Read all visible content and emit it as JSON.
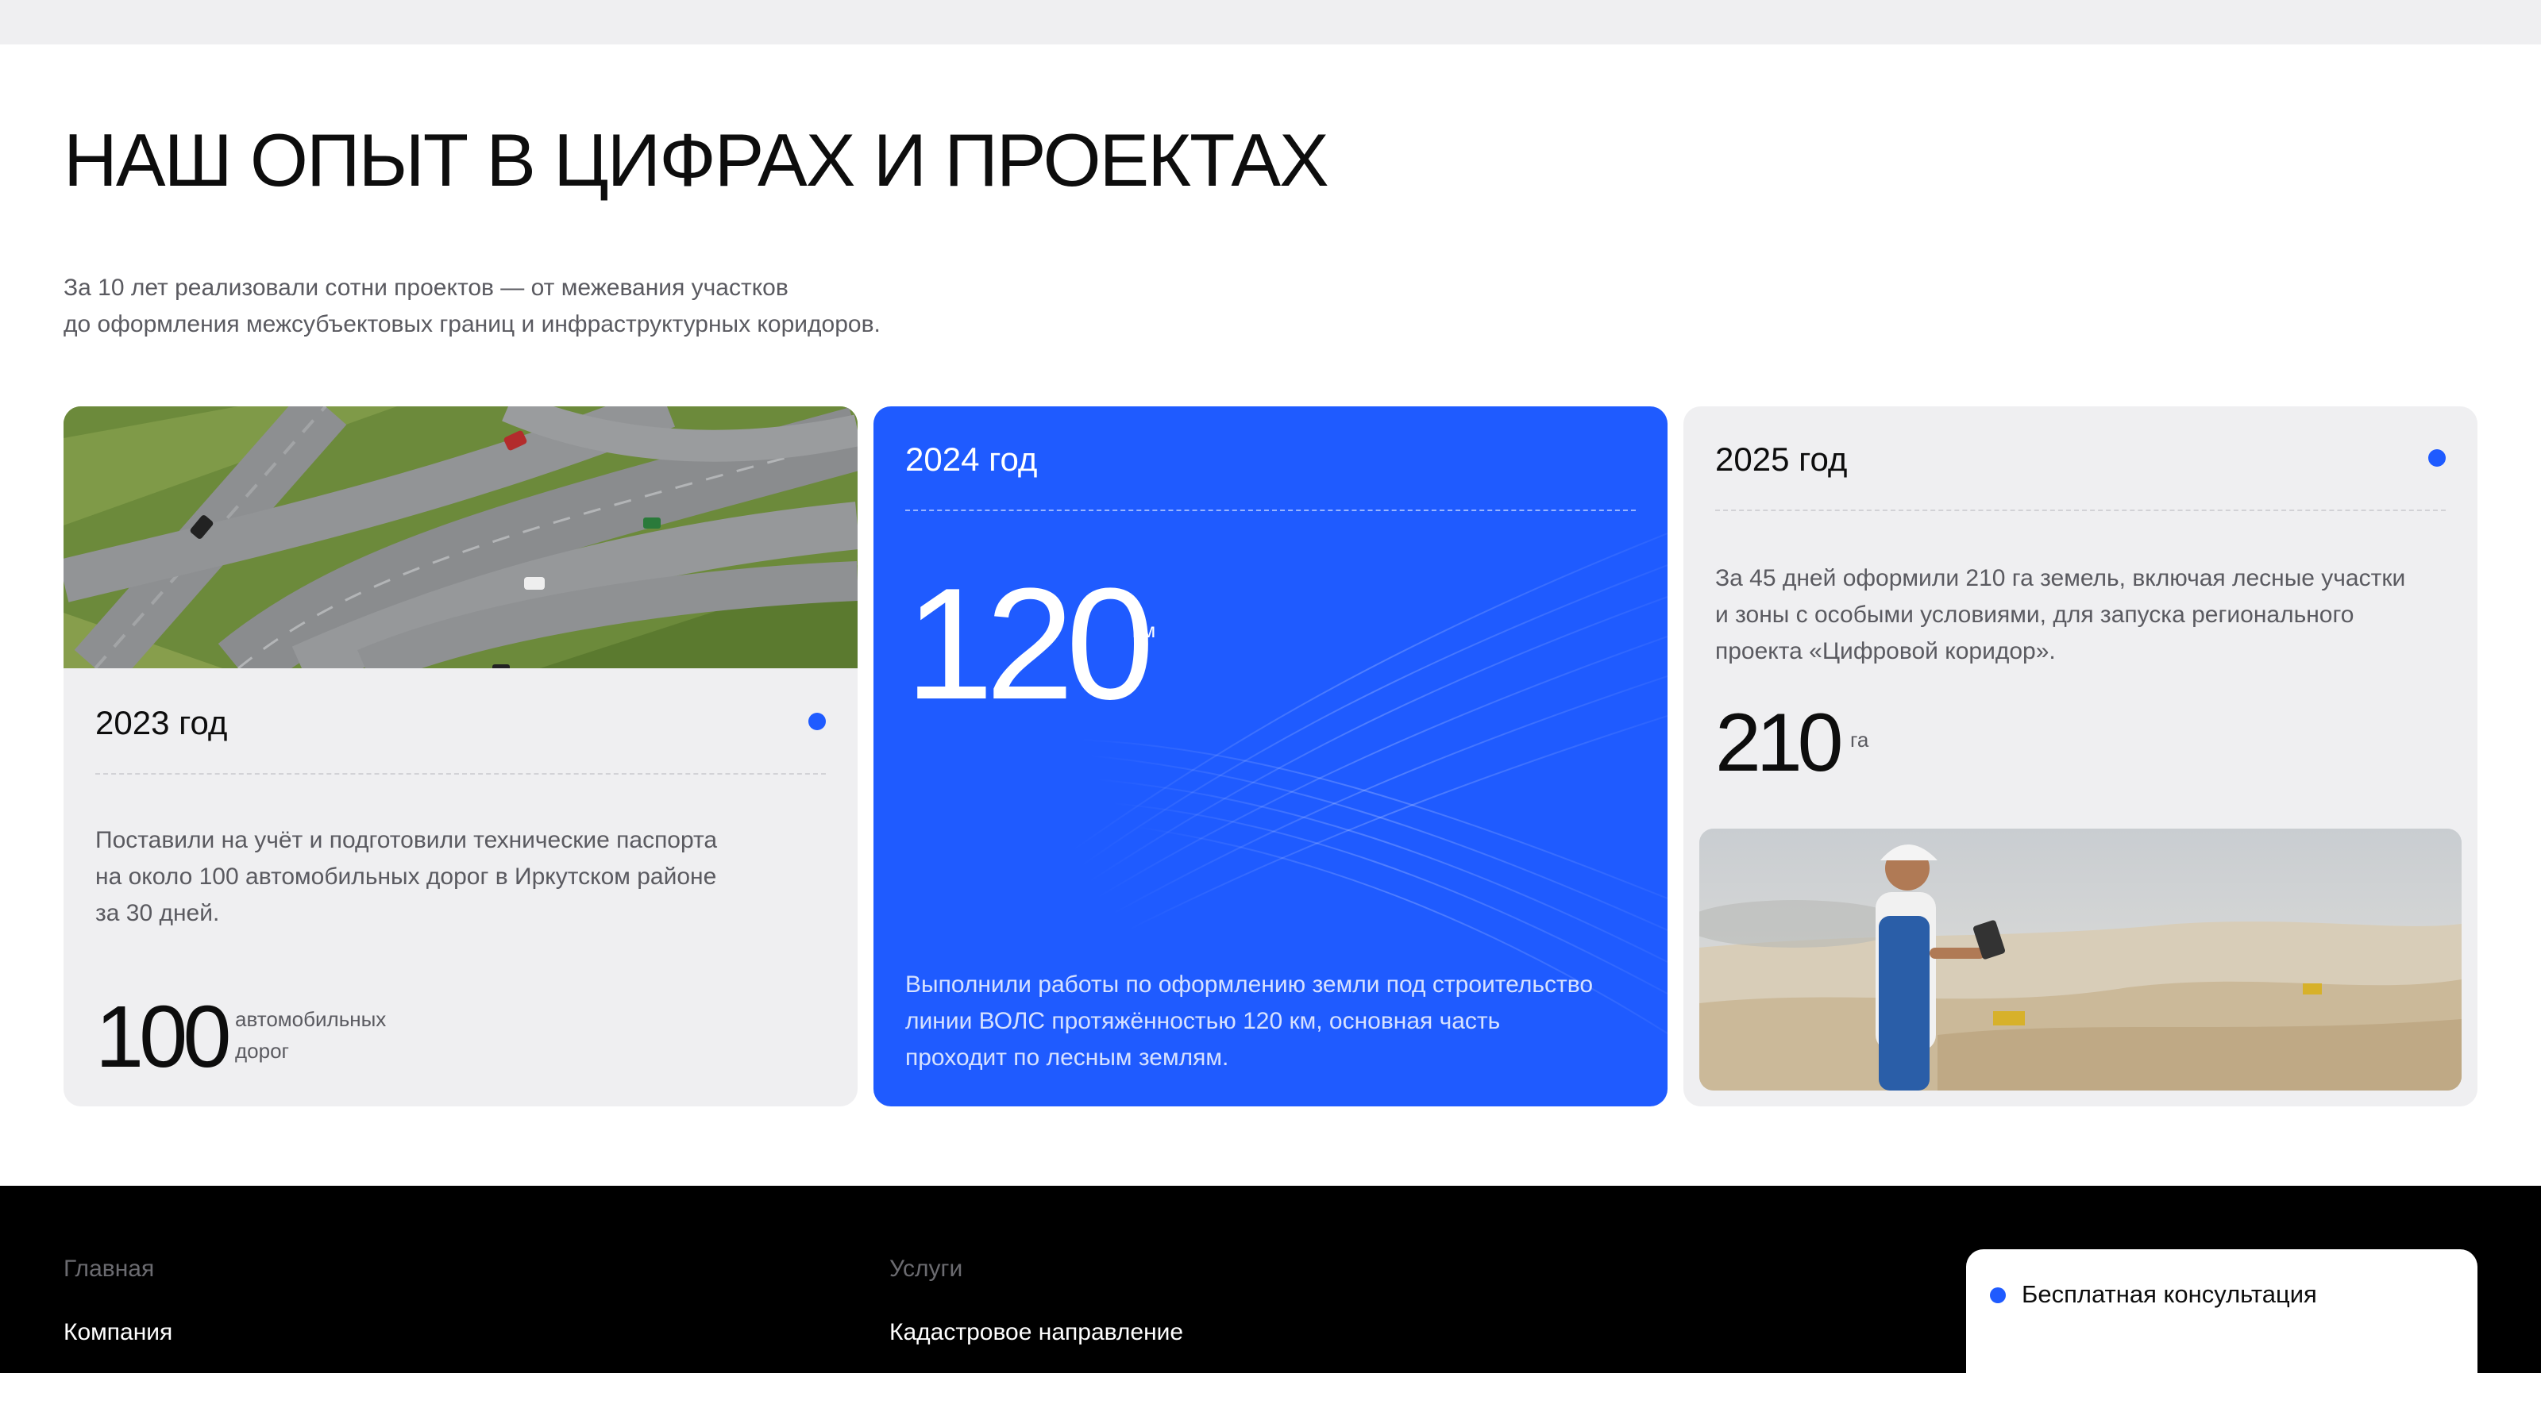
{
  "section": {
    "title": "НАШ ОПЫТ В ЦИФРАХ И ПРОЕКТАХ",
    "subtitle_line1": "За 10 лет реализовали сотни проектов — от межевания участков",
    "subtitle_line2": "до оформления межсубъектовых границ и инфраструктурных коридоров."
  },
  "cards": [
    {
      "year": "2023 год",
      "description_lines": [
        "Поставили на учёт и подготовили технические паспорта",
        "на около 100 автомобильных дорог в Иркутском районе",
        "за 30 дней."
      ],
      "value": "100",
      "unit_lines": [
        "автомобильных",
        "дорог"
      ],
      "image": "highway-interchange-aerial-photo"
    },
    {
      "year": "2024 год",
      "value": "120",
      "unit": "км",
      "description_lines": [
        "Выполнили работы по оформлению земли под строительство",
        "линии ВОЛС протяжённостью 120 км, основная часть",
        "проходит по лесным землям."
      ]
    },
    {
      "year": "2025 год",
      "description_lines": [
        "За 45 дней оформили 210 га земель, включая лесные участки",
        "и зоны с особыми условиями, для запуска регионального",
        "проекта «Цифровой коридор»."
      ],
      "value": "210",
      "unit": "га",
      "image": "surveyor-with-tablet-photo"
    }
  ],
  "footer": {
    "col1_header": "Главная",
    "col1_link": "Компания",
    "col2_header": "Услуги",
    "col2_link": "Кадастровое направление",
    "consult_label": "Бесплатная консультация"
  },
  "colors": {
    "accent": "#1f5bff",
    "card_bg": "#efeff1",
    "footer_bg": "#000000"
  }
}
